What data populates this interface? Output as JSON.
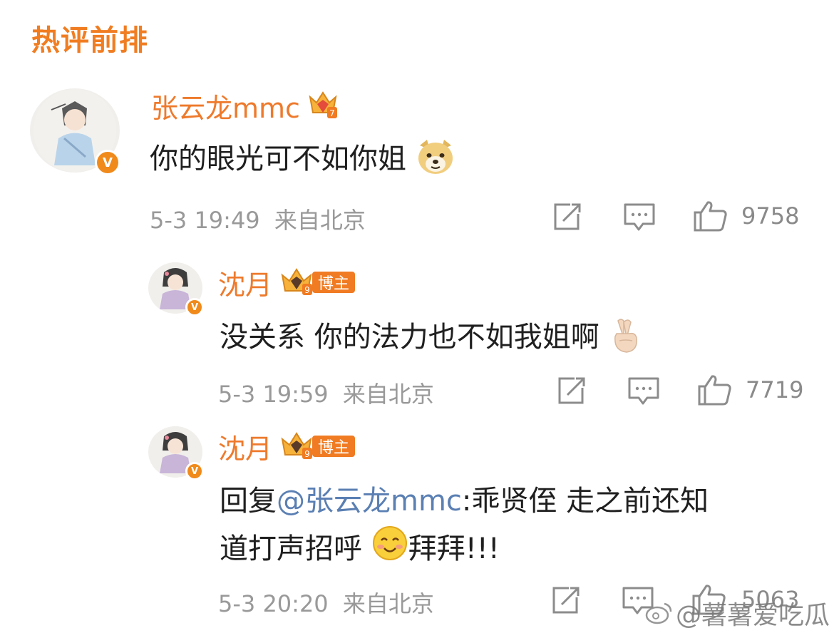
{
  "section": {
    "title": "热评前排"
  },
  "comments": [
    {
      "name": "张云龙mmc",
      "crown_level": "7",
      "verified_badge": "V",
      "text_before_emoji": "你的眼光可不如你姐",
      "emoji": "doge-emoji",
      "time": "5-3 19:49",
      "location": "来自北京",
      "likes": "9758"
    },
    {
      "name": "沈月",
      "crown_level": "9",
      "badge": "博主",
      "verified_badge": "V",
      "text_before_emoji": "没关系 你的法力也不如我姐啊",
      "emoji": "crossed-fingers-emoji",
      "time": "5-3 19:59",
      "location": "来自北京",
      "likes": "7719"
    },
    {
      "name": "沈月",
      "crown_level": "9",
      "badge": "博主",
      "verified_badge": "V",
      "reply_prefix": "回复",
      "mention": "@张云龙mmc",
      "line1_rest": ":乖贤侄 走之前还知",
      "line2_before_emoji": "道打声招呼",
      "emoji": "smile-emoji",
      "line2_after_emoji": "拜拜!!!",
      "time": "5-3 20:20",
      "location": "来自北京",
      "likes": "5063"
    }
  ],
  "watermark": {
    "text": "@薯薯爱吃瓜"
  },
  "colors": {
    "accent": "#f07d22",
    "username": "#ee7a2c",
    "mention": "#5a7fb3",
    "meta": "#999999",
    "text": "#1f1f1f"
  }
}
